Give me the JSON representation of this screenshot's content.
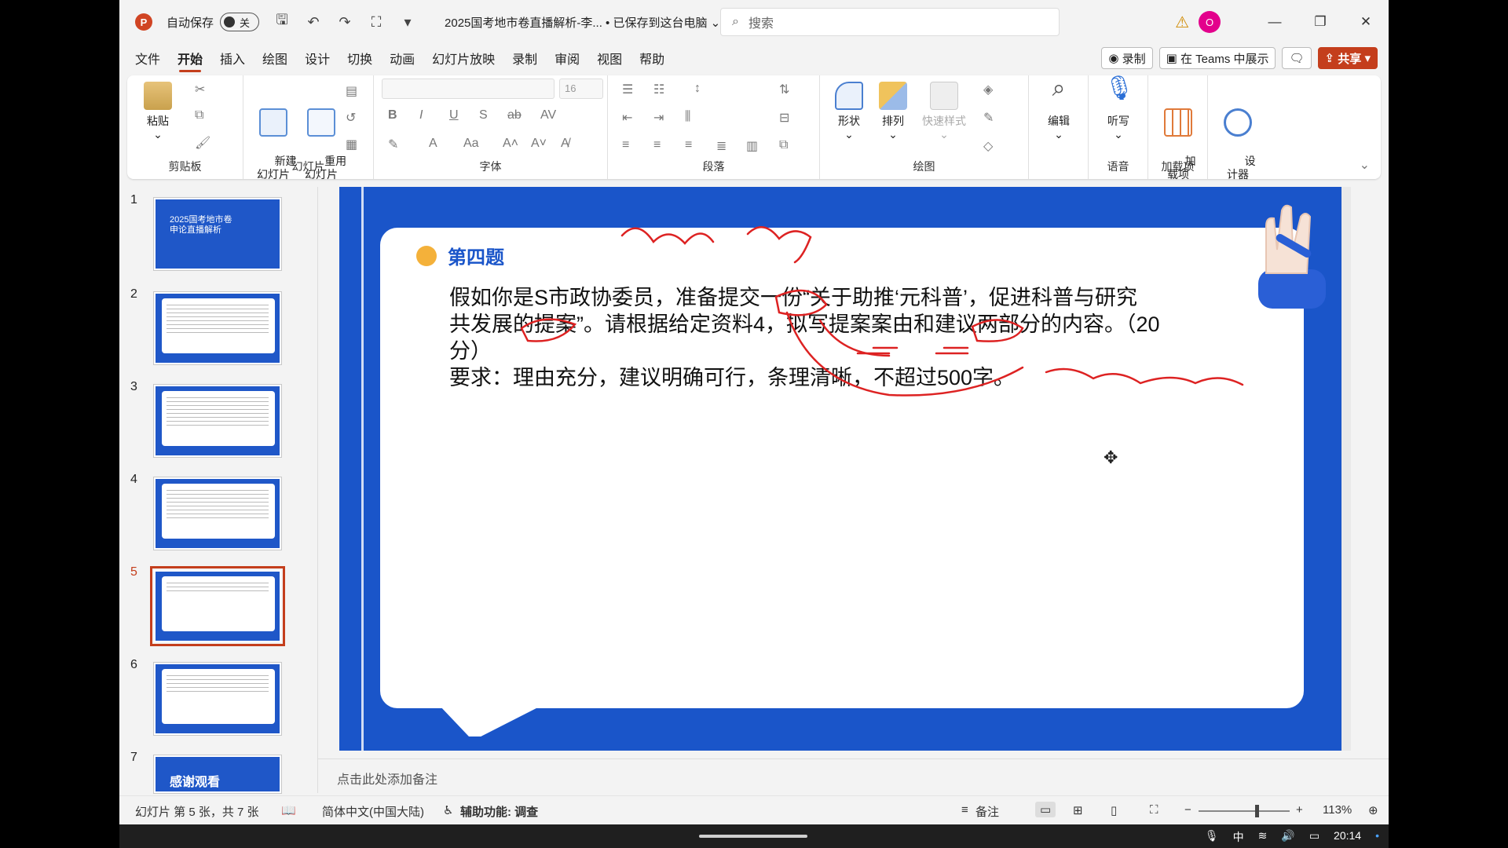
{
  "titlebar": {
    "autosave_label": "自动保存",
    "autosave_state": "关",
    "doc_title": "2025国考地市卷直播解析-李... • 已保存到这台电脑 ⌄",
    "search_placeholder": "搜索",
    "avatar_initial": "O"
  },
  "menu": {
    "items": [
      "文件",
      "开始",
      "插入",
      "绘图",
      "设计",
      "切换",
      "动画",
      "幻灯片放映",
      "录制",
      "审阅",
      "视图",
      "帮助"
    ],
    "record_label": "录制",
    "teams_label": "在 Teams 中展示",
    "share_label": "共享"
  },
  "ribbon": {
    "clipboard": {
      "paste": "粘贴",
      "group": "剪贴板"
    },
    "slides": {
      "new_slide": "新建\n幻灯片",
      "reuse": "重用\n幻灯片",
      "group": "幻灯片"
    },
    "font": {
      "size": "16",
      "group": "字体"
    },
    "paragraph": {
      "group": "段落"
    },
    "drawing": {
      "shape": "形状",
      "arrange": "排列",
      "quick_style": "快速样式",
      "group": "绘图"
    },
    "editing": {
      "label": "编辑"
    },
    "voice": {
      "dictate": "听写",
      "group": "语音"
    },
    "addins": {
      "label": "加\n载项",
      "group": "加载项"
    },
    "designer": {
      "label": "设\n计器"
    }
  },
  "thumbnails": [
    {
      "num": "1",
      "title": "2025国考地市卷\n申论直播解析"
    },
    {
      "num": "2"
    },
    {
      "num": "3"
    },
    {
      "num": "4"
    },
    {
      "num": "5"
    },
    {
      "num": "6"
    },
    {
      "num": "7",
      "title": "感谢观看"
    }
  ],
  "slide": {
    "question_title": "第四题",
    "question_line1": "假如你是S市政协委员，准备提交一份“关于助推‘元科普’，促进科普与研究",
    "question_line2": "共发展的提案”。请根据给定资料4，拟写提案案由和建议两部分的内容。（20",
    "question_line3": "分）",
    "requirement": "要求：理由充分，建议明确可行，条理清晰，不超过500字。"
  },
  "notes_placeholder": "点击此处添加备注",
  "status": {
    "slide_info": "幻灯片 第 5 张，共 7 张",
    "language": "简体中文(中国大陆)",
    "accessibility": "辅助功能: 调查",
    "notes": "备注",
    "zoom": "113%"
  },
  "taskbar": {
    "ime": "中",
    "time": "20:14"
  }
}
